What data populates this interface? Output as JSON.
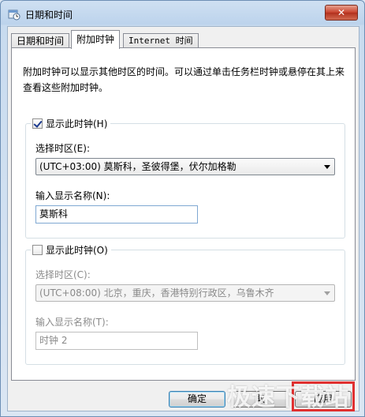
{
  "window": {
    "title": "日期和时间",
    "close_glyph": "✕"
  },
  "tabs": [
    {
      "label": "日期和时间"
    },
    {
      "label": "附加时钟"
    },
    {
      "label": "Internet 时间"
    }
  ],
  "description": "附加时钟可以显示其他时区的时间。可以通过单击任务栏时钟或悬停在其上来查看这些附加时钟。",
  "clock1": {
    "checkbox_label": "显示此时钟(H)",
    "checked": true,
    "timezone_label": "选择时区(E):",
    "timezone_value": "(UTC+03:00) 莫斯科，圣彼得堡，伏尔加格勒",
    "name_label": "输入显示名称(N):",
    "name_value": "莫斯科"
  },
  "clock2": {
    "checkbox_label": "显示此时钟(O)",
    "checked": false,
    "timezone_label": "选择时区(C):",
    "timezone_value": "(UTC+08:00) 北京，重庆，香港特别行政区，乌鲁木齐",
    "name_label": "输入显示名称(T):",
    "name_value": "时钟 2"
  },
  "buttons": {
    "ok": "确定",
    "cancel": "取",
    "apply": "应用"
  },
  "watermark": "极速下载站",
  "colors": {
    "close": "#c8402b",
    "highlight": "#e03030"
  }
}
